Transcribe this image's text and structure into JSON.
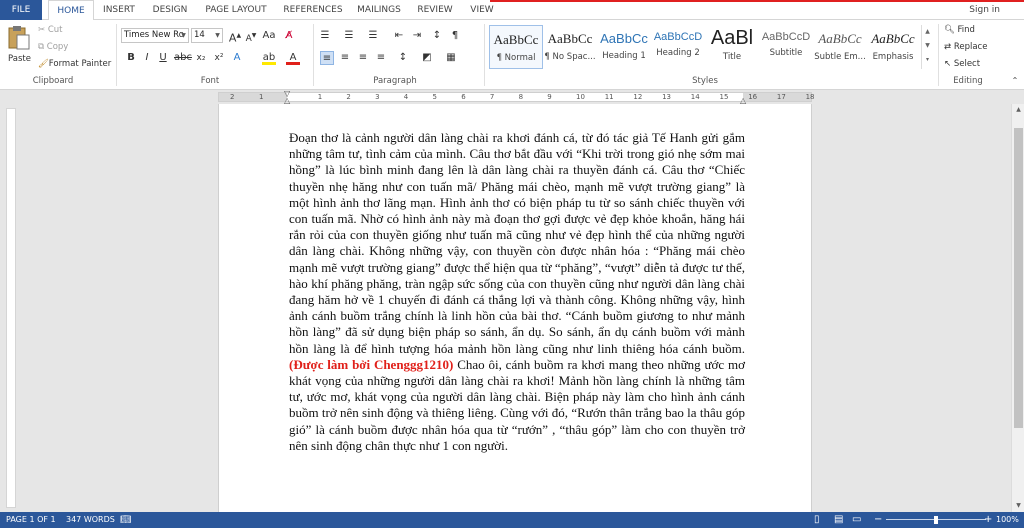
{
  "tabs": [
    "FILE",
    "HOME",
    "INSERT",
    "DESIGN",
    "PAGE LAYOUT",
    "REFERENCES",
    "MAILINGS",
    "REVIEW",
    "VIEW"
  ],
  "sign_in": "Sign in",
  "clipboard": {
    "paste": "Paste",
    "cut": "Cut",
    "copy": "Copy",
    "format_painter": "Format Painter",
    "label": "Clipboard"
  },
  "font": {
    "name": "Times New Ro",
    "size": "14",
    "label": "Font"
  },
  "paragraph": {
    "label": "Paragraph"
  },
  "styles": {
    "label": "Styles",
    "items": [
      {
        "sample": "AaBbCc",
        "name": "¶ Normal"
      },
      {
        "sample": "AaBbCc",
        "name": "¶ No Spac..."
      },
      {
        "sample": "AaBbCc",
        "name": "Heading 1"
      },
      {
        "sample": "AaBbCcD",
        "name": "Heading 2"
      },
      {
        "sample": "AaBl",
        "name": "Title"
      },
      {
        "sample": "AaBbCcD",
        "name": "Subtitle"
      },
      {
        "sample": "AaBbCc",
        "name": "Subtle Em..."
      },
      {
        "sample": "AaBbCc",
        "name": "Emphasis"
      }
    ]
  },
  "editing": {
    "find": "Find",
    "replace": "Replace",
    "select": "Select",
    "label": "Editing"
  },
  "ruler_numbers": [
    "2",
    "1",
    "1",
    "2",
    "3",
    "4",
    "5",
    "6",
    "7",
    "8",
    "9",
    "10",
    "11",
    "12",
    "13",
    "14",
    "15",
    "16",
    "17",
    "18"
  ],
  "document": {
    "before_red": "Đoạn thơ là cảnh người dân làng chài ra khơi đánh cá, từ đó tác giả Tế Hanh gửi gắm những tâm tư, tình cảm của mình. Câu thơ bắt đầu với “Khi trời trong gió nhẹ sớm mai hồng” là lúc bình minh đang lên là dân làng chài ra thuyền đánh cá. Câu thơ “Chiếc thuyền nhẹ hăng như con tuấn mã/ Phăng mái chèo, mạnh mẽ vượt trường giang” là một hình ảnh thơ lãng mạn. Hình ảnh thơ có biện pháp tu từ so sánh chiếc thuyền với con tuấn mã. Nhờ có hình ảnh này mà đoạn thơ gợi được vẻ đẹp khỏe khoắn, hăng hái rắn rỏi của con thuyền giống như tuấn mã cũng như vẻ đẹp hình thể của những người dân làng chài. Không những vậy, con thuyền còn được nhân hóa : “Phăng mái chèo mạnh mẽ vượt trường giang” được thể hiện qua từ “phăng”, “vượt” diễn tả được tư thế, hào khí phăng phăng, tràn ngập sức sống của con thuyền cũng như người dân làng chài đang hăm hở về 1 chuyến đi đánh cá thắng lợi và thành công. Không những vậy, hình ảnh cánh buồm trắng chính là linh hồn của bài thơ. “Cánh buồm giương to như mảnh hồn làng” đã sử dụng biện pháp so sánh, ẩn dụ. So sánh, ẩn dụ cánh buồm với mảnh hồn làng là để hình tượng hóa mảnh hồn làng cũng như linh thiêng hóa cánh buồm. ",
    "red": "(Được làm bởi Chenggg1210)",
    "after_red": " Chao ôi, cánh buồm ra khơi mang theo những ước mơ khát vọng của những người dân làng chài ra khơi! Mảnh hồn làng chính là những tâm tư, ước mơ, khát vọng của người dân làng chài. Biện pháp này làm cho hình ảnh cánh buồm trở nên sinh động và thiêng liêng. Cùng với đó, “Rướn thân trắng bao la thâu góp gió” là cánh buồm được nhân hóa qua từ “rướn” , “thâu góp” làm cho con thuyền trở nên sinh động chân thực như 1 con người."
  },
  "status": {
    "page": "PAGE 1 OF 1",
    "words": "347 WORDS",
    "zoom": "100%"
  },
  "colors": {
    "brand": "#2b579a",
    "red_text": "#e0201a"
  }
}
